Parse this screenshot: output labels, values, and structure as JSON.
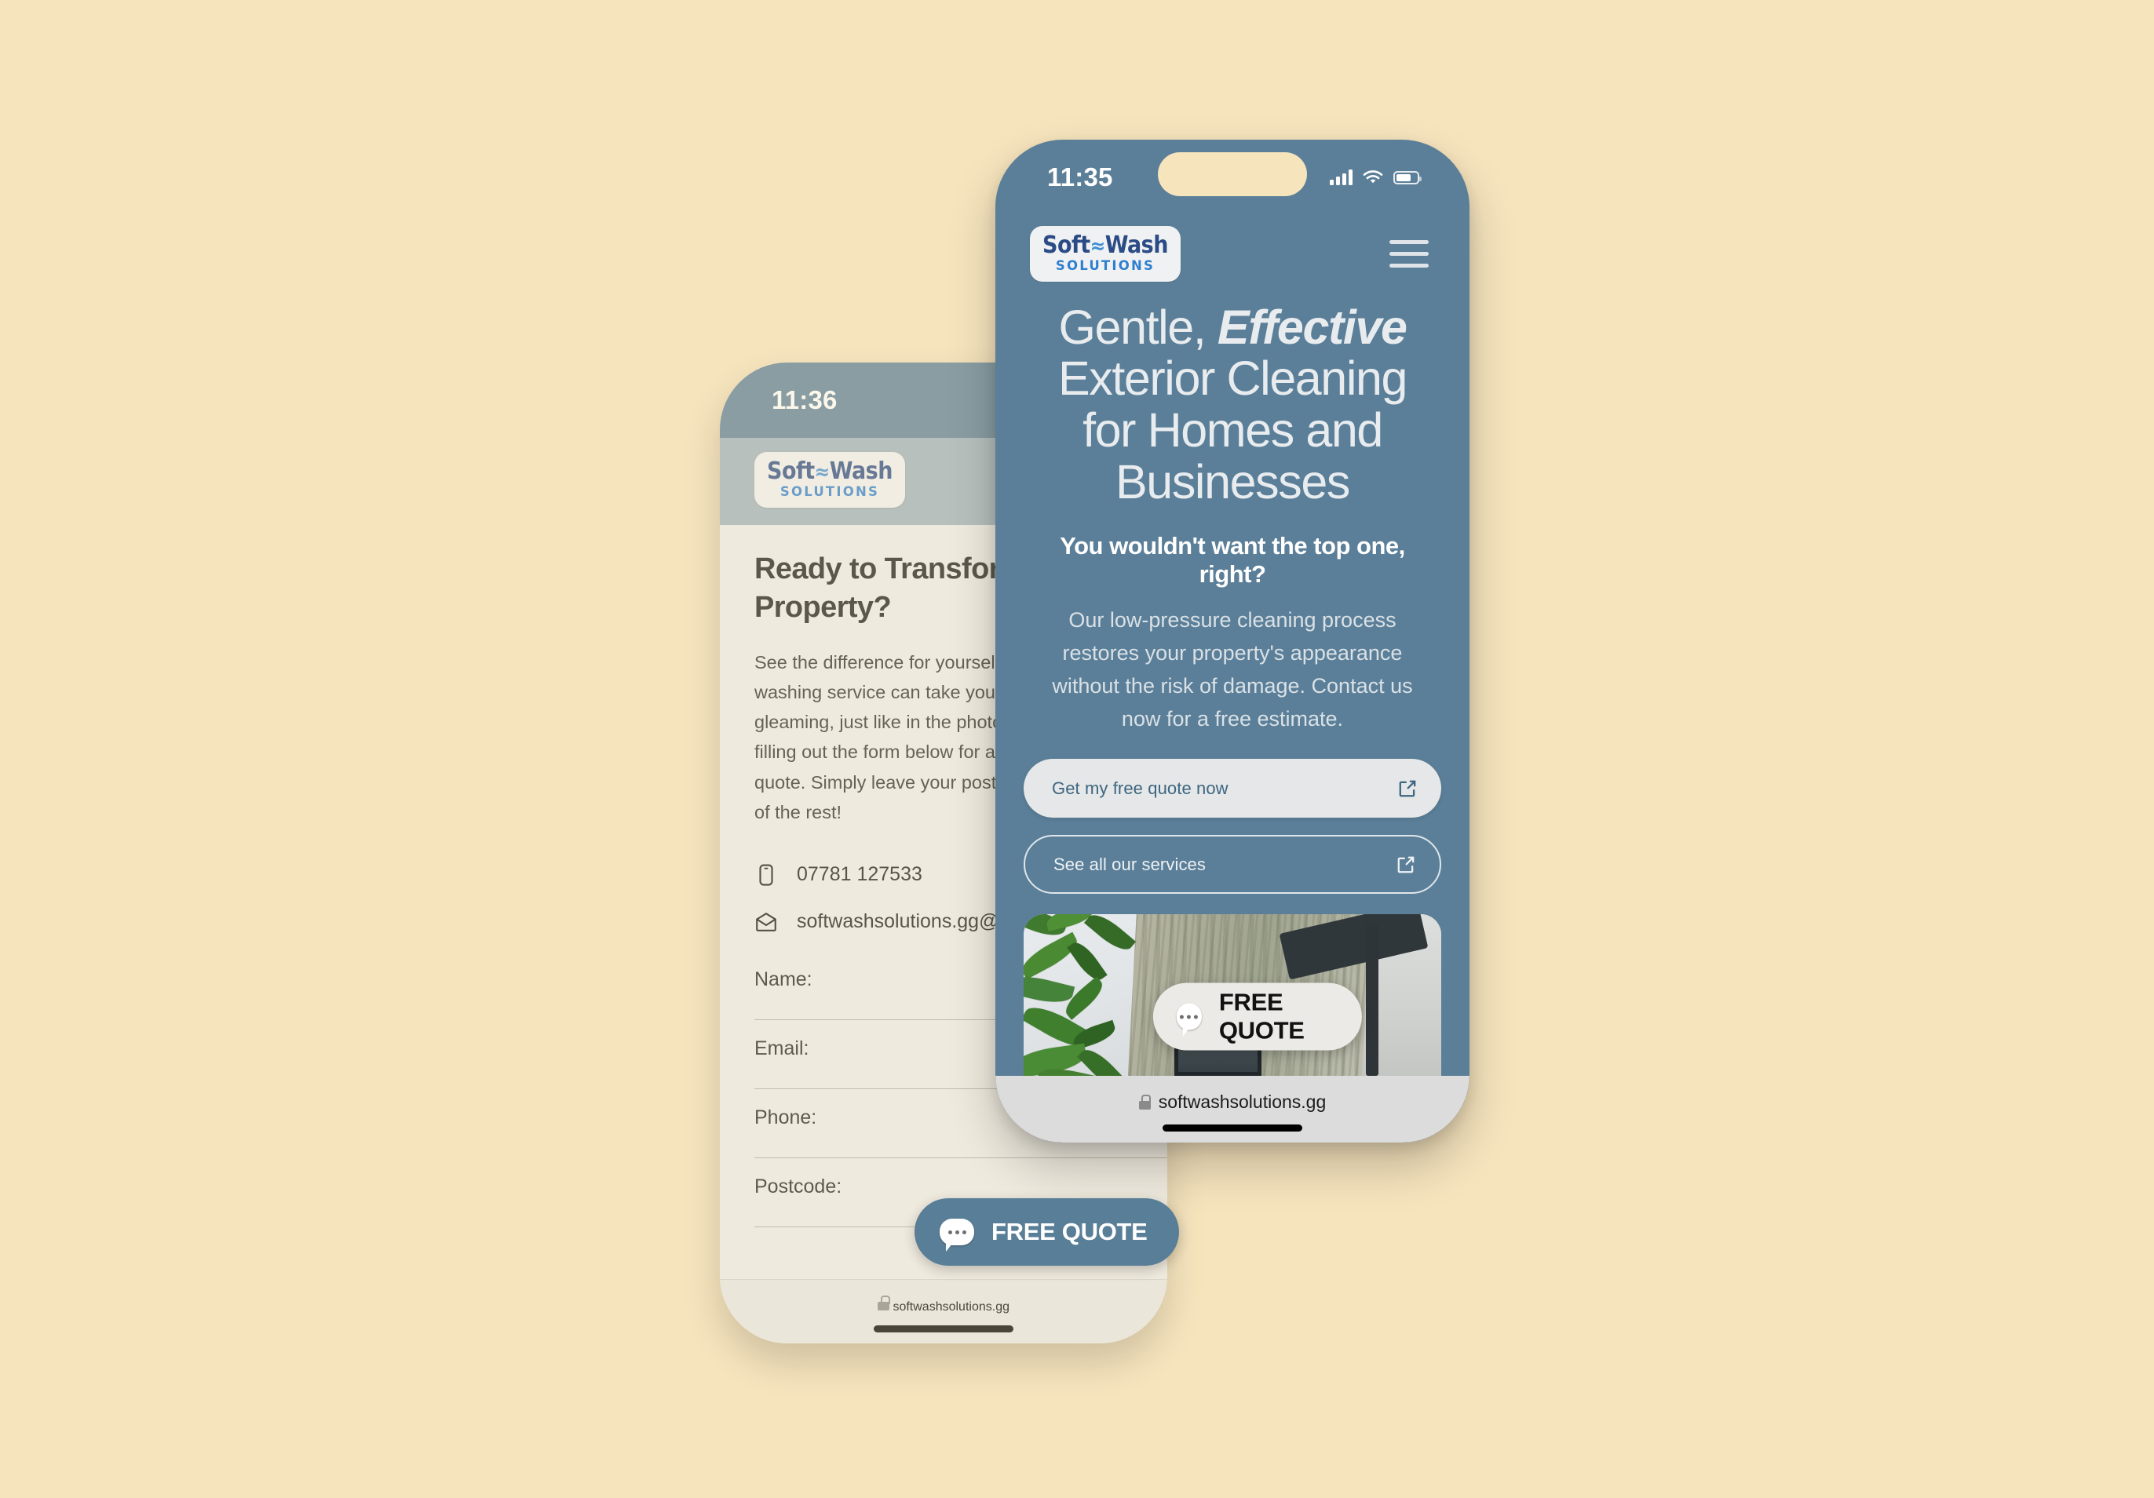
{
  "canvas": {
    "background_color": "#f6e4bd"
  },
  "brand": {
    "logo_main": "Soft",
    "logo_wave": "≈",
    "logo_main2": "Wash",
    "logo_sub": "SOLUTIONS",
    "accent_color": "#5b7f98",
    "logo_navy": "#2b4b86",
    "logo_blue": "#2f7fd0"
  },
  "front_phone": {
    "status": {
      "time": "11:35",
      "signal_icon": "cellular-bars-icon",
      "wifi_icon": "wifi-icon",
      "battery_icon": "battery-icon"
    },
    "header": {
      "menu_icon": "hamburger-menu-icon"
    },
    "hero": {
      "title_line1_a": "Gentle, ",
      "title_line1_b": "Effective",
      "title_line2": "Exterior Cleaning",
      "title_line3": "for Homes and",
      "title_line4": "Businesses",
      "subtitle": "You wouldn't want the top one, right?",
      "body": "Our low-pressure cleaning process restores your property's appearance without the risk of damage. Contact us now for a free estimate."
    },
    "buttons": [
      {
        "label": "Get my free quote now",
        "icon": "external-link-icon",
        "style": "solid"
      },
      {
        "label": "See all our services",
        "icon": "external-link-icon",
        "style": "ghost"
      }
    ],
    "photo": {
      "alt": "dirty-render-wall-before-cleaning"
    },
    "floating_cta": {
      "label": "FREE QUOTE",
      "icon": "chat-bubble-icon"
    },
    "browser": {
      "url": "softwashsolutions.gg",
      "lock_icon": "lock-icon"
    }
  },
  "back_phone": {
    "status": {
      "time": "11:36"
    },
    "content": {
      "heading": "Ready to Transform Your Property?",
      "heading_line1": "Ready to Transform Your",
      "heading_line2": "Property?",
      "paragraph_lines": [
        "See the difference for yourself! Our soft",
        "washing service can take your home to",
        "gleaming, just like in the photo. Get started by",
        "filling out the form below for a free, no-obligation",
        "quote. Simply leave your postcode and we'll do all",
        "of the rest!"
      ],
      "phone_number": "07781 127533",
      "phone_icon": "mobile-phone-icon",
      "email": "softwashsolutions.gg@gmail.com",
      "email_icon": "envelope-icon"
    },
    "form": {
      "fields": [
        {
          "label": "Name:",
          "value": "",
          "placeholder": ""
        },
        {
          "label": "Email:",
          "value": "",
          "placeholder": ""
        },
        {
          "label": "Phone:",
          "value": "",
          "placeholder": ""
        },
        {
          "label": "Postcode:",
          "value": "",
          "placeholder": ""
        }
      ]
    },
    "floating_cta": {
      "label": "FREE QUOTE",
      "icon": "chat-bubble-icon"
    },
    "browser": {
      "url": "softwashsolutions.gg",
      "lock_icon": "lock-icon"
    }
  }
}
